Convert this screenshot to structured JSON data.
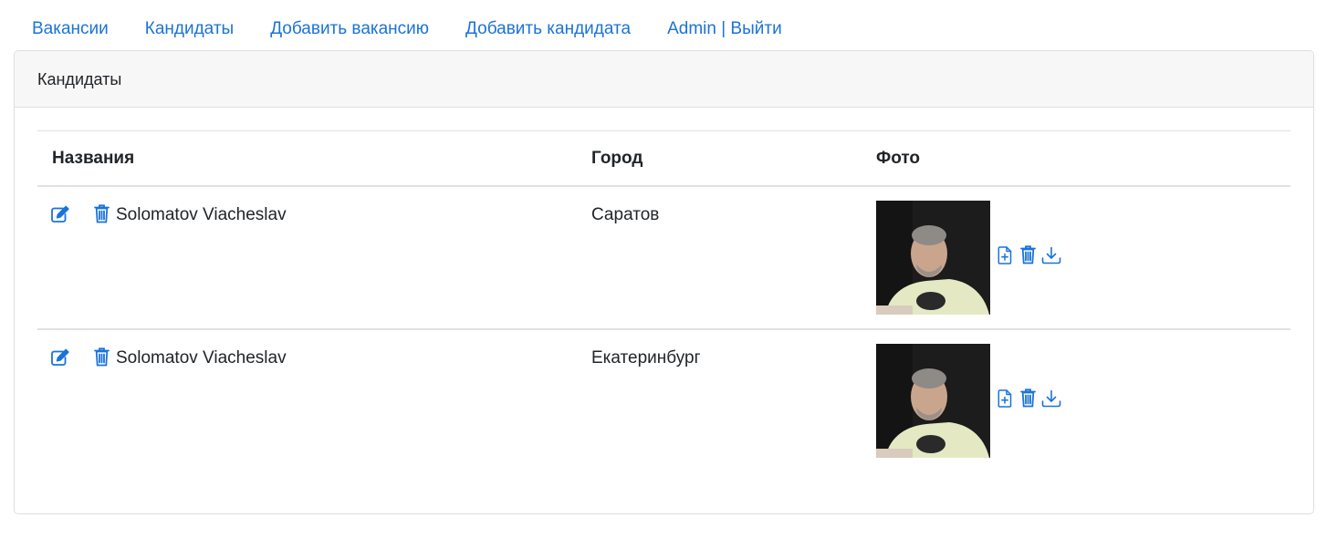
{
  "nav": {
    "links": [
      {
        "label": "Вакансии"
      },
      {
        "label": "Кандидаты"
      },
      {
        "label": "Добавить вакансию"
      },
      {
        "label": "Добавить кандидата"
      },
      {
        "label": "Admin | Выйти"
      }
    ]
  },
  "card": {
    "title": "Кандидаты"
  },
  "table": {
    "headers": {
      "name": "Названия",
      "city": "Город",
      "photo": "Фото"
    },
    "rows": [
      {
        "name": "Solomatov Viacheslav",
        "city": "Саратов",
        "icons": {
          "edit": "edit-icon",
          "delete": "trash-icon",
          "upload": "file-plus-icon",
          "photo_delete": "trash-icon",
          "download": "download-icon"
        }
      },
      {
        "name": "Solomatov Viacheslav",
        "city": "Екатеринбург",
        "icons": {
          "edit": "edit-icon",
          "delete": "trash-icon",
          "upload": "file-plus-icon",
          "photo_delete": "trash-icon",
          "download": "download-icon"
        }
      }
    ]
  },
  "colors": {
    "accent": "#1a73d9",
    "header_bg": "#f7f7f7",
    "border": "#dee2e6"
  }
}
